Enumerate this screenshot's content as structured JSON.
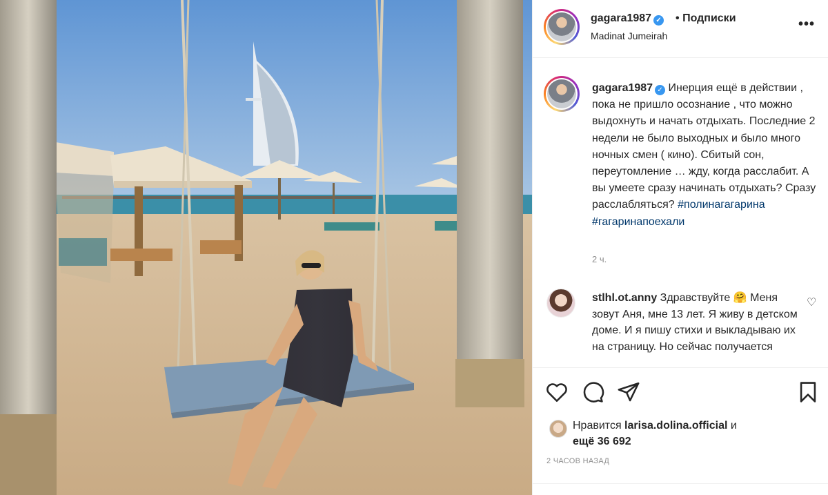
{
  "post": {
    "username": "gagara1987",
    "dot": "•",
    "follow_label": "Подписки",
    "location": "Madinat Jumeirah",
    "more_label": "•••"
  },
  "caption": {
    "username": "gagara1987",
    "text": " Инерция ещё в действии , пока не пришло осознание , что можно выдохнуть и начать отдыхать. Последние 2 недели не было выходных и было много ночных смен ( кино). Сбитый сон, переутомление … жду, когда расслабит. А вы умеете сразу начинать отдыхать? Сразу расслабляться? ",
    "hashtag1": "#полинагагарина",
    "hashtag2": "#гагаринапоехали",
    "time": "2 ч."
  },
  "comment": {
    "username": "stlhl.ot.anny",
    "text": " Здравствуйте 🤗 Меня зовут Аня, мне 13 лет. Я живу в детском доме. И я пишу стихи и выкладываю их на страницу. Но сейчас получается"
  },
  "actions": {
    "icons": [
      "heart-icon",
      "comment-icon",
      "share-icon",
      "bookmark-icon"
    ]
  },
  "likes": {
    "prefix": "Нравится ",
    "user": "larisa.dolina.official",
    "suffix": " и",
    "count_text": "ещё 36 692"
  },
  "posted_ago": "2 ЧАСОВ НАЗАД",
  "colors": {
    "link": "#00376b",
    "verified": "#3897f0",
    "muted": "#8e8e8e"
  }
}
